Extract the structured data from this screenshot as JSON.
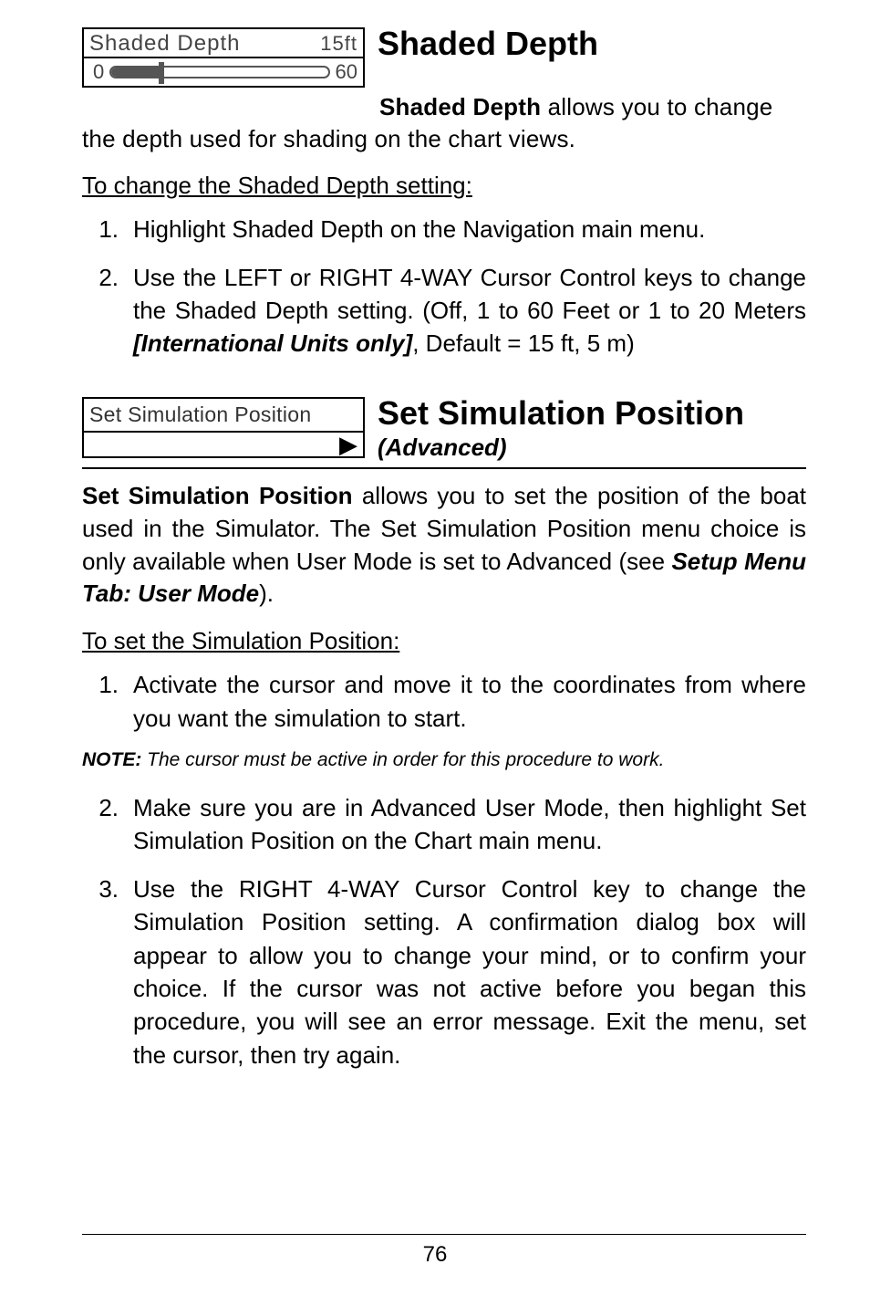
{
  "shaded": {
    "uiLabel": "Shaded Depth",
    "uiValue": "15ft",
    "sliderMin": "0",
    "sliderMax": "60",
    "heading": "Shaded Depth",
    "introBold": "Shaded Depth",
    "introRest": " allows you to change the depth used for shading on the chart views.",
    "subhead": "To change the Shaded Depth setting:",
    "step1": "Highlight Shaded Depth on the Navigation main menu.",
    "step2a": "Use the LEFT or RIGHT 4-WAY Cursor Control keys to change the Shaded Depth setting. (Off, 1 to 60 Feet or 1 to 20 Meters ",
    "step2ital": "[International Units only]",
    "step2b": ", Default = 15 ft, 5 m)"
  },
  "sim": {
    "uiLabel": "Set Simulation Position",
    "arrow": "▶",
    "heading": "Set Simulation Position",
    "subheadIt": "(Advanced)",
    "p1bold": "Set Simulation Position",
    "p1a": " allows you to set the position of the boat used in the Simulator. The Set Simulation Position menu choice is only available when User Mode is set to Advanced (see ",
    "p1ital": "Setup Menu Tab: User Mode",
    "p1b": ").",
    "subhead2": "To set the Simulation Position:",
    "step1": "Activate the cursor and move it to the coordinates from where you want the simulation to start.",
    "noteLabel": "NOTE:",
    "noteText": " The cursor must be active in order for this procedure to work.",
    "step2": "Make sure you are in Advanced User Mode, then highlight Set Simulation Position on the Chart main menu.",
    "step3": "Use the RIGHT 4-WAY Cursor Control key to change the Simulation Position setting. A confirmation dialog box will appear to allow you to change your mind, or to confirm your choice. If the cursor was not active before you began this procedure, you will see an error message. Exit the menu, set the cursor, then try again."
  },
  "pageNumber": "76"
}
